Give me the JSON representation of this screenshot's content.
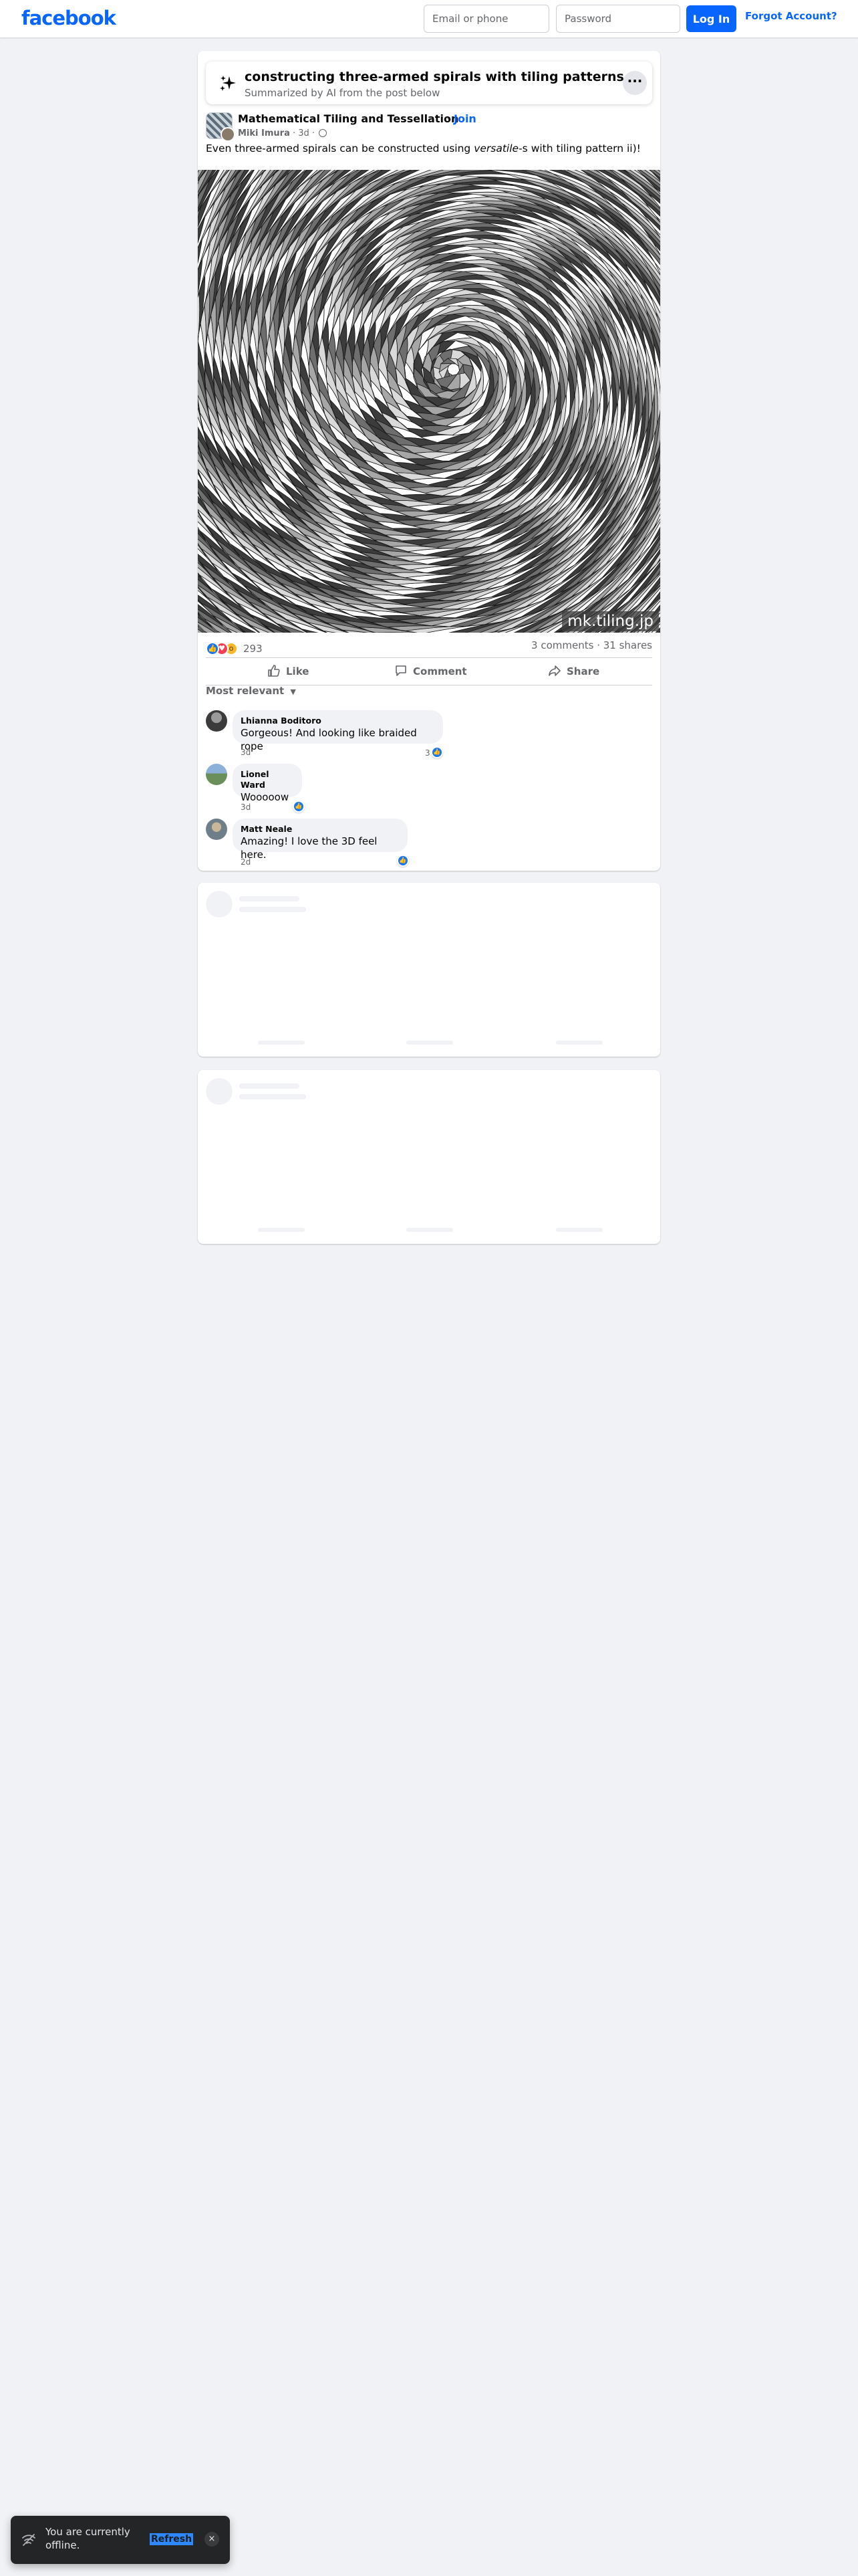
{
  "header": {
    "logo": "facebook",
    "email_placeholder": "Email or phone",
    "password_placeholder": "Password",
    "login_label": "Log In",
    "forgot_label": "Forgot Account?"
  },
  "ai_summary": {
    "title": "constructing three-armed spirals with tiling patterns",
    "subtitle": "Summarized by AI from the post below",
    "more_label": "···"
  },
  "post": {
    "group_name": "Mathematical Tiling and Tessellation",
    "join_label": "Join",
    "author": "Miki Imura",
    "time": "3d",
    "text_before": "Even three-armed spirals can be constructed using ",
    "text_italic": "versatile",
    "text_after": "-s with tiling pattern ii)!",
    "image_watermark": "mk.tiling.jp",
    "reaction_count": "293",
    "comments_count": "3 comments",
    "shares_count": "31 shares",
    "counts_separator": " · ",
    "reaction_icons": [
      "like-icon",
      "love-icon",
      "wow-icon"
    ]
  },
  "actions": {
    "like": "Like",
    "comment": "Comment",
    "share": "Share"
  },
  "comments_filter": "Most relevant",
  "comments": [
    {
      "name": "Lhianna Boditoro",
      "text": "Gorgeous! And looking like braided rope",
      "time": "3d",
      "reactions": "3"
    },
    {
      "name": "Lionel Ward",
      "text": "Wooooow",
      "time": "3d",
      "reactions": ""
    },
    {
      "name": "Matt Neale",
      "text": "Amazing! I love the 3D feel here.",
      "time": "2d",
      "reactions": ""
    }
  ],
  "toast": {
    "message": "You are currently offline.",
    "refresh_label": "Refresh",
    "close_label": "×"
  },
  "colors": {
    "brand": "#0866ff",
    "background": "#f0f2f5",
    "like_reaction": "#1877f2",
    "love_reaction": "#f33e58",
    "wow_reaction": "#f7b928"
  }
}
